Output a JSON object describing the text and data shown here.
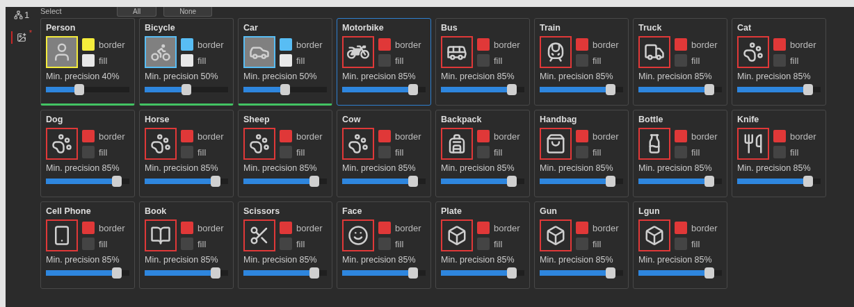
{
  "header": {
    "label": "Select",
    "buttons": [
      "All",
      "None"
    ]
  },
  "sidebar": {
    "items": [
      {
        "label": "1",
        "selected": false
      },
      {
        "marker": "*",
        "selected": true
      }
    ]
  },
  "cards": [
    {
      "name": "Person",
      "color": "#f4ec3c",
      "border_label": "border",
      "fill": true,
      "fill_label": "fill",
      "precision": "Min. precision 40%",
      "level": 0.4,
      "enabled": true,
      "selected": false
    },
    {
      "name": "Bicycle",
      "color": "#58bdf4",
      "border_label": "border",
      "fill": true,
      "fill_label": "fill",
      "precision": "Min. precision 50%",
      "level": 0.5,
      "enabled": true,
      "selected": false
    },
    {
      "name": "Car",
      "color": "#58bdf4",
      "border_label": "border",
      "fill": true,
      "fill_label": "fill",
      "precision": "Min. precision 50%",
      "level": 0.5,
      "enabled": true,
      "selected": false
    },
    {
      "name": "Motorbike",
      "color": "#e03838",
      "border_label": "border",
      "fill": false,
      "fill_label": "fill",
      "precision": "Min. precision 85%",
      "level": 0.85,
      "enabled": false,
      "selected": true
    },
    {
      "name": "Bus",
      "color": "#e03838",
      "border_label": "border",
      "fill": false,
      "fill_label": "fill",
      "precision": "Min. precision 85%",
      "level": 0.85,
      "enabled": false,
      "selected": false
    },
    {
      "name": "Train",
      "color": "#e03838",
      "border_label": "border",
      "fill": false,
      "fill_label": "fill",
      "precision": "Min. precision 85%",
      "level": 0.85,
      "enabled": false,
      "selected": false
    },
    {
      "name": "Truck",
      "color": "#e03838",
      "border_label": "border",
      "fill": false,
      "fill_label": "fill",
      "precision": "Min. precision 85%",
      "level": 0.85,
      "enabled": false,
      "selected": false
    },
    {
      "name": "Cat",
      "color": "#e03838",
      "border_label": "border",
      "fill": false,
      "fill_label": "fill",
      "precision": "Min. precision 85%",
      "level": 0.85,
      "enabled": false,
      "selected": false
    },
    {
      "name": "Dog",
      "color": "#e03838",
      "border_label": "border",
      "fill": false,
      "fill_label": "fill",
      "precision": "Min. precision 85%",
      "level": 0.85,
      "enabled": false,
      "selected": false
    },
    {
      "name": "Horse",
      "color": "#e03838",
      "border_label": "border",
      "fill": false,
      "fill_label": "fill",
      "precision": "Min. precision 85%",
      "level": 0.85,
      "enabled": false,
      "selected": false
    },
    {
      "name": "Sheep",
      "color": "#e03838",
      "border_label": "border",
      "fill": false,
      "fill_label": "fill",
      "precision": "Min. precision 85%",
      "level": 0.85,
      "enabled": false,
      "selected": false
    },
    {
      "name": "Cow",
      "color": "#e03838",
      "border_label": "border",
      "fill": false,
      "fill_label": "fill",
      "precision": "Min. precision 85%",
      "level": 0.85,
      "enabled": false,
      "selected": false
    },
    {
      "name": "Backpack",
      "color": "#e03838",
      "border_label": "border",
      "fill": false,
      "fill_label": "fill",
      "precision": "Min. precision 85%",
      "level": 0.85,
      "enabled": false,
      "selected": false
    },
    {
      "name": "Handbag",
      "color": "#e03838",
      "border_label": "border",
      "fill": false,
      "fill_label": "fill",
      "precision": "Min. precision 85%",
      "level": 0.85,
      "enabled": false,
      "selected": false
    },
    {
      "name": "Bottle",
      "color": "#e03838",
      "border_label": "border",
      "fill": false,
      "fill_label": "fill",
      "precision": "Min. precision 85%",
      "level": 0.85,
      "enabled": false,
      "selected": false
    },
    {
      "name": "Knife",
      "color": "#e03838",
      "border_label": "border",
      "fill": false,
      "fill_label": "fill",
      "precision": "Min. precision 85%",
      "level": 0.85,
      "enabled": false,
      "selected": false
    },
    {
      "name": "Cell Phone",
      "color": "#e03838",
      "border_label": "border",
      "fill": false,
      "fill_label": "fill",
      "precision": "Min. precision 85%",
      "level": 0.85,
      "enabled": false,
      "selected": false
    },
    {
      "name": "Book",
      "color": "#e03838",
      "border_label": "border",
      "fill": false,
      "fill_label": "fill",
      "precision": "Min. precision 85%",
      "level": 0.85,
      "enabled": false,
      "selected": false
    },
    {
      "name": "Scissors",
      "color": "#e03838",
      "border_label": "border",
      "fill": false,
      "fill_label": "fill",
      "precision": "Min. precision 85%",
      "level": 0.85,
      "enabled": false,
      "selected": false
    },
    {
      "name": "Face",
      "color": "#e03838",
      "border_label": "border",
      "fill": false,
      "fill_label": "fill",
      "precision": "Min. precision 85%",
      "level": 0.85,
      "enabled": false,
      "selected": false
    },
    {
      "name": "Plate",
      "color": "#e03838",
      "border_label": "border",
      "fill": false,
      "fill_label": "fill",
      "precision": "Min. precision 85%",
      "level": 0.85,
      "enabled": false,
      "selected": false
    },
    {
      "name": "Gun",
      "color": "#e03838",
      "border_label": "border",
      "fill": false,
      "fill_label": "fill",
      "precision": "Min. precision 85%",
      "level": 0.85,
      "enabled": false,
      "selected": false
    },
    {
      "name": "Lgun",
      "color": "#e03838",
      "border_label": "border",
      "fill": false,
      "fill_label": "fill",
      "precision": "Min. precision 85%",
      "level": 0.85,
      "enabled": false,
      "selected": false
    }
  ]
}
